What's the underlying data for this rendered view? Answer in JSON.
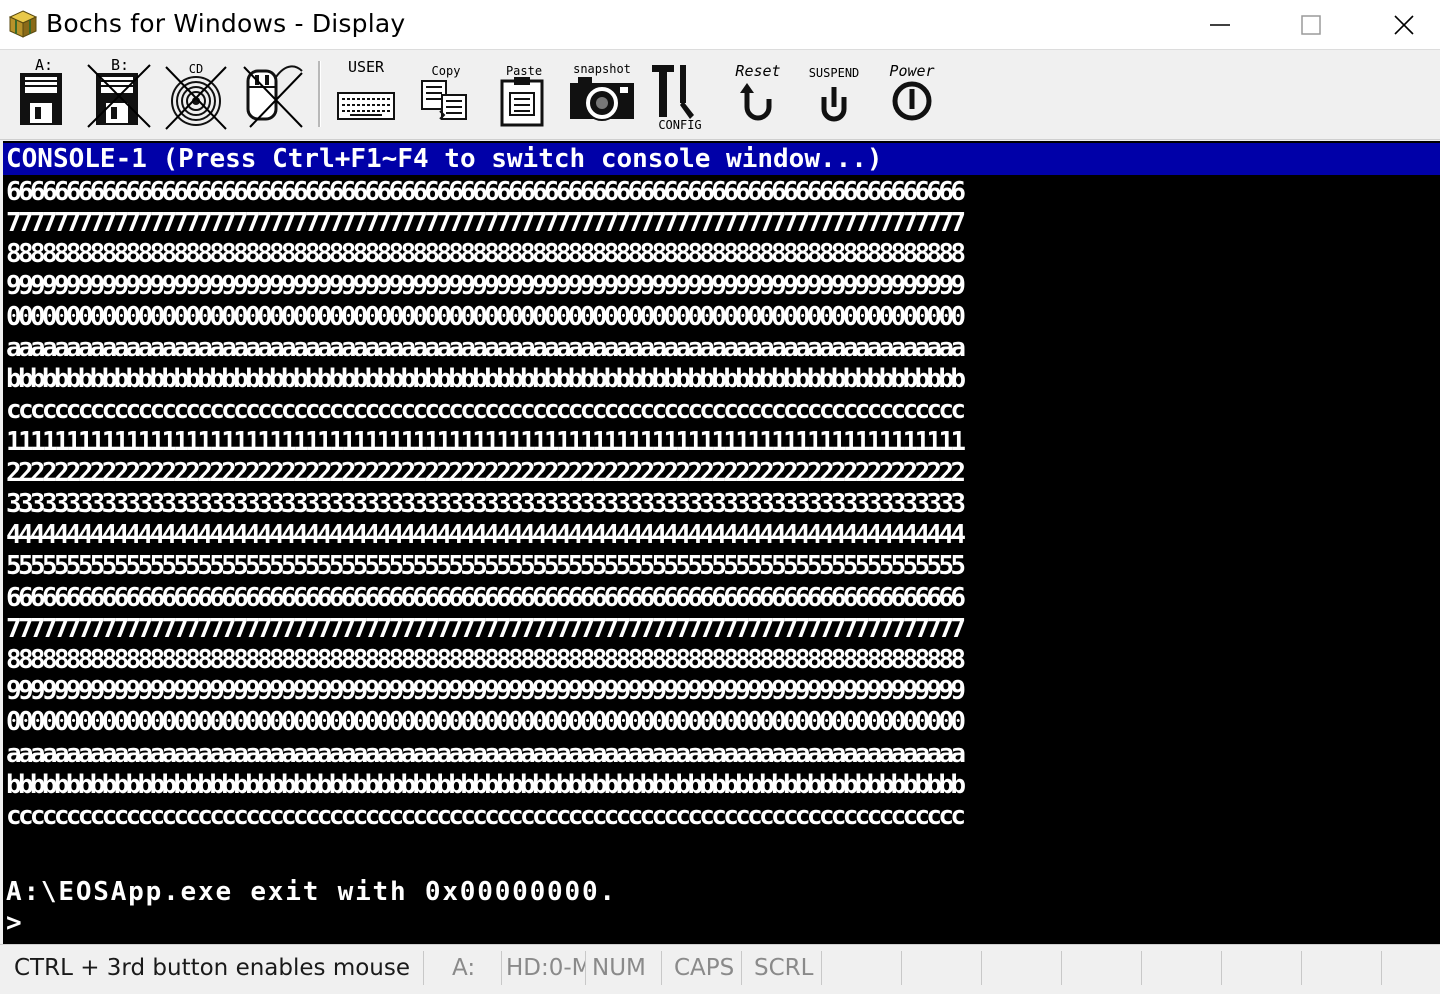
{
  "window": {
    "title": "Bochs for Windows - Display",
    "controls": [
      "minimize",
      "maximize",
      "close"
    ]
  },
  "toolbar": {
    "buttons": [
      {
        "name": "floppy-a",
        "label": "A:"
      },
      {
        "name": "floppy-b",
        "label": "B:"
      },
      {
        "name": "cdrom",
        "label": "CD"
      },
      {
        "name": "mouse",
        "label": ""
      },
      {
        "name": "user",
        "label": "USER"
      },
      {
        "name": "copy",
        "label": "Copy"
      },
      {
        "name": "paste",
        "label": "Paste"
      },
      {
        "name": "snapshot",
        "label": "snapshot"
      },
      {
        "name": "config",
        "label": "CONFIG"
      },
      {
        "name": "reset",
        "label": "Reset"
      },
      {
        "name": "suspend",
        "label": "SUSPEND"
      },
      {
        "name": "power",
        "label": "Power"
      }
    ]
  },
  "console": {
    "header": "CONSOLE-1 (Press Ctrl+F1~F4 to switch console window...)",
    "lines": [
      "66666666666666666666666666666666666666666666666666666666666666666666666666666666",
      "77777777777777777777777777777777777777777777777777777777777777777777777777777777",
      "88888888888888888888888888888888888888888888888888888888888888888888888888888888",
      "99999999999999999999999999999999999999999999999999999999999999999999999999999999",
      "00000000000000000000000000000000000000000000000000000000000000000000000000000000",
      "aaaaaaaaaaaaaaaaaaaaaaaaaaaaaaaaaaaaaaaaaaaaaaaaaaaaaaaaaaaaaaaaaaaaaaaaaaaaaaaa",
      "bbbbbbbbbbbbbbbbbbbbbbbbbbbbbbbbbbbbbbbbbbbbbbbbbbbbbbbbbbbbbbbbbbbbbbbbbbbbbbbb",
      "cccccccccccccccccccccccccccccccccccccccccccccccccccccccccccccccccccccccccccccccc",
      "11111111111111111111111111111111111111111111111111111111111111111111111111111111",
      "22222222222222222222222222222222222222222222222222222222222222222222222222222222",
      "33333333333333333333333333333333333333333333333333333333333333333333333333333333",
      "44444444444444444444444444444444444444444444444444444444444444444444444444444444",
      "55555555555555555555555555555555555555555555555555555555555555555555555555555555",
      "66666666666666666666666666666666666666666666666666666666666666666666666666666666",
      "77777777777777777777777777777777777777777777777777777777777777777777777777777777",
      "88888888888888888888888888888888888888888888888888888888888888888888888888888888",
      "99999999999999999999999999999999999999999999999999999999999999999999999999999999",
      "00000000000000000000000000000000000000000000000000000000000000000000000000000000",
      "aaaaaaaaaaaaaaaaaaaaaaaaaaaaaaaaaaaaaaaaaaaaaaaaaaaaaaaaaaaaaaaaaaaaaaaaaaaaaaaa",
      "bbbbbbbbbbbbbbbbbbbbbbbbbbbbbbbbbbbbbbbbbbbbbbbbbbbbbbbbbbbbbbbbbbbbbbbbbbbbbbbb",
      "cccccccccccccccccccccccccccccccccccccccccccccccccccccccccccccccccccccccccccccccc"
    ],
    "blank_line": "",
    "exit_message": "A:\\EOSApp.exe exit with 0x00000000.",
    "prompt": ">"
  },
  "statusbar": {
    "mouse_hint": "CTRL + 3rd button enables mouse",
    "drive": "A:",
    "hd": "HD:0-M",
    "num": "NUM",
    "caps": "CAPS",
    "scrl": "SCRL"
  },
  "colors": {
    "console_header_bg": "#0000a8",
    "console_bg": "#000000",
    "console_fg": "#ffffff",
    "chrome_bg": "#f0f0f0"
  }
}
